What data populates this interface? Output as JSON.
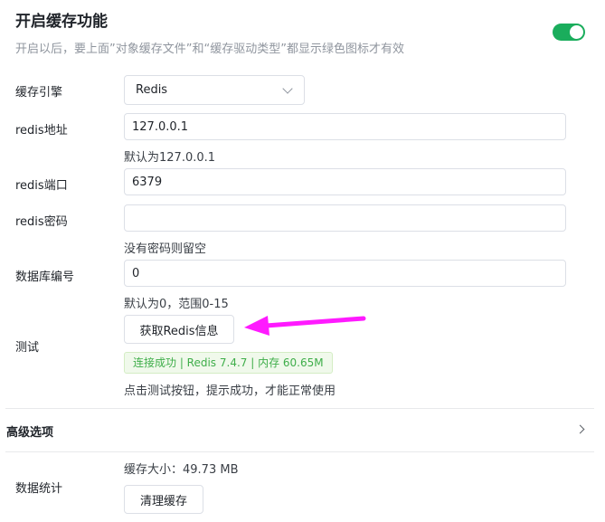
{
  "header": {
    "title": "开启缓存功能",
    "subtitle": "开启以后，要上面”对象缓存文件”和“缓存驱动类型”都显示绿色图标才有效",
    "toggle_on": true,
    "accent_color": "#1aad5c"
  },
  "form": {
    "engine": {
      "label": "缓存引擎",
      "value": "Redis"
    },
    "address": {
      "label": "redis地址",
      "value": "127.0.0.1",
      "help": "默认为127.0.0.1"
    },
    "port": {
      "label": "redis端口",
      "value": "6379"
    },
    "password": {
      "label": "redis密码",
      "value": "",
      "help": "没有密码则留空"
    },
    "database": {
      "label": "数据库编号",
      "value": "0",
      "help": "默认为0，范围0-15"
    },
    "test": {
      "label": "测试",
      "button": "获取Redis信息",
      "status": "连接成功 | Redis 7.4.7 | 内存 60.65M",
      "help": "点击测试按钮，提示成功，才能正常使用"
    }
  },
  "advanced": {
    "label": "高级选项"
  },
  "stats": {
    "label": "数据统计",
    "cache_size": "缓存大小：49.73 MB",
    "clear_button": "清理缓存"
  },
  "annotation": {
    "arrow_color": "#ff1aff",
    "arrow_icon": "arrow-left-icon"
  }
}
